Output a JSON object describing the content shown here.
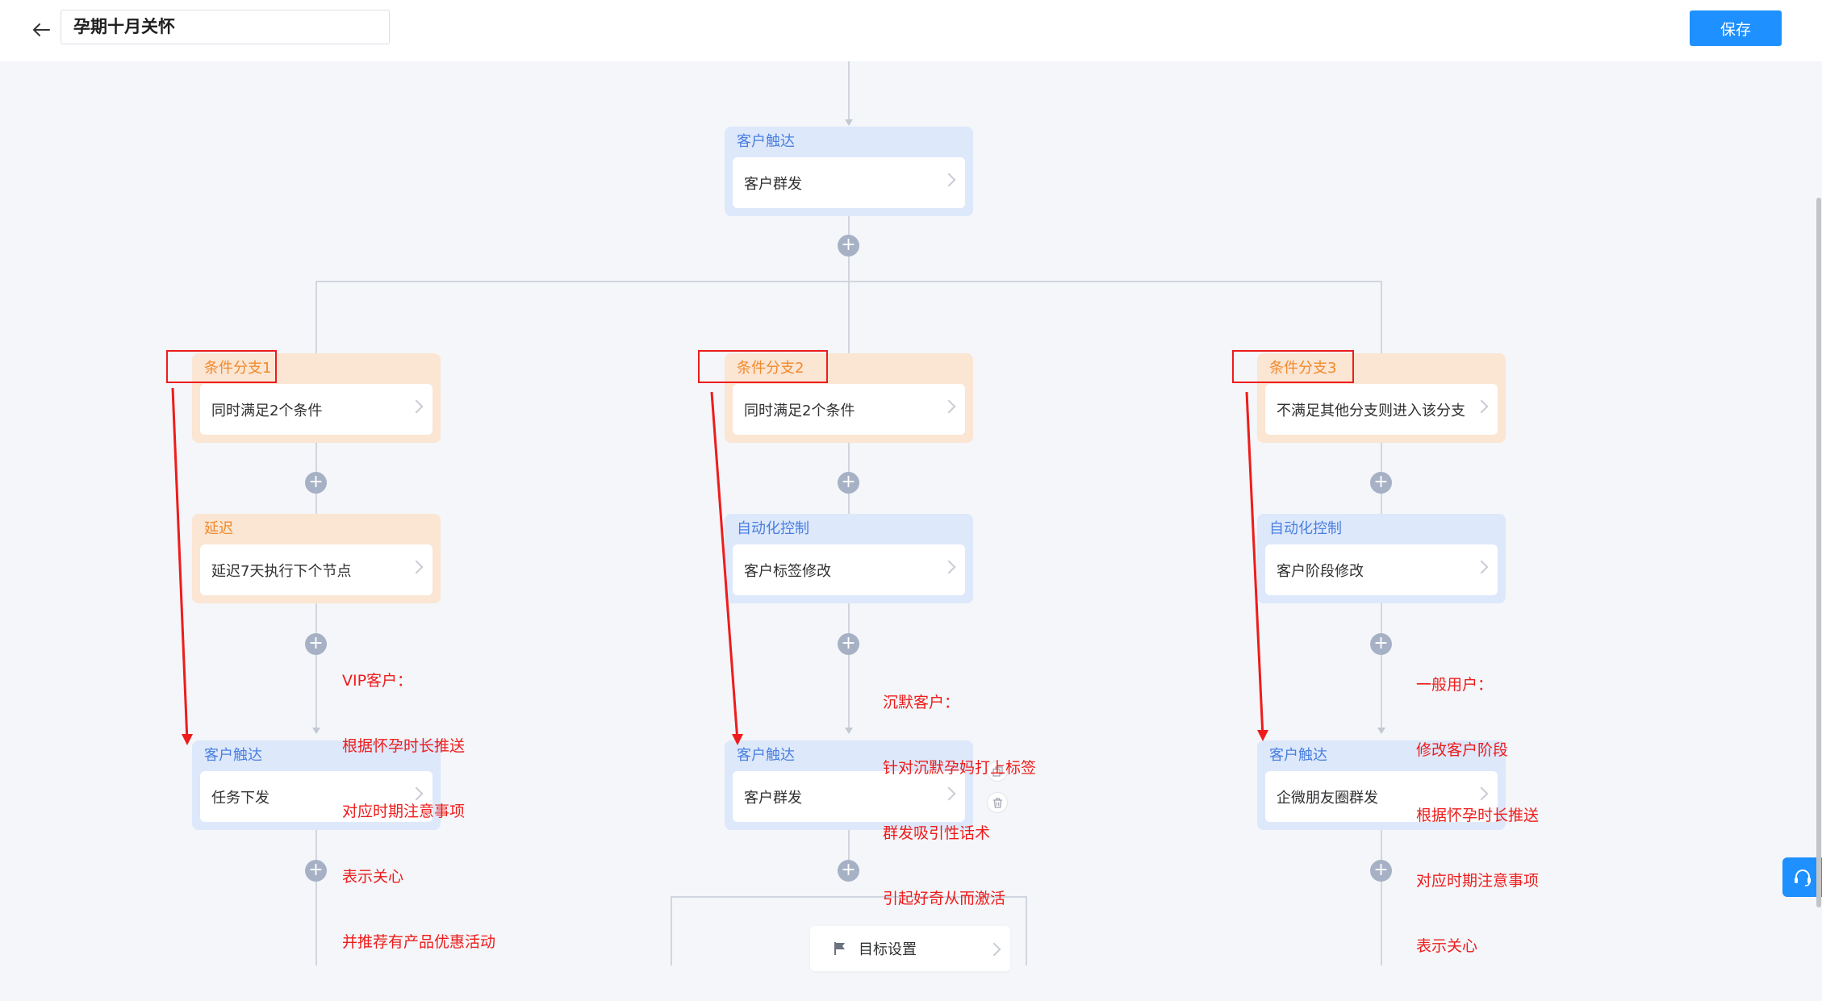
{
  "header": {
    "back_icon": "arrow-left-icon",
    "title": "孕期十月关怀",
    "save_label": "保存"
  },
  "colors": {
    "primary": "#1e90ff",
    "blue_node_bg": "#dde8fb",
    "orange_node_bg": "#fbe5d3",
    "annotation_red": "#ee1c1c"
  },
  "flow": {
    "top_node": {
      "type": "客户触达",
      "action": "客户群发"
    },
    "branches": [
      {
        "condition": {
          "type": "条件分支1",
          "action": "同时满足2个条件"
        },
        "step2": {
          "type": "延迟",
          "action": "延迟7天执行下个节点"
        },
        "step3": {
          "type": "客户触达",
          "action": "任务下发"
        },
        "annotation": [
          "VIP客户：",
          "根据怀孕时长推送",
          "对应时期注意事项",
          "表示关心",
          "并推荐有产品优惠活动"
        ]
      },
      {
        "condition": {
          "type": "条件分支2",
          "action": "同时满足2个条件"
        },
        "step2": {
          "type": "自动化控制",
          "action": "客户标签修改"
        },
        "step3": {
          "type": "客户触达",
          "action": "客户群发"
        },
        "annotation": [
          "沉默客户：",
          "针对沉默孕妈打上标签",
          "群发吸引性话术",
          "引起好奇从而激活"
        ]
      },
      {
        "condition": {
          "type": "条件分支3",
          "action": "不满足其他分支则进入该分支"
        },
        "step2": {
          "type": "自动化控制",
          "action": "客户阶段修改"
        },
        "step3": {
          "type": "客户触达",
          "action": "企微朋友圈群发"
        },
        "annotation": [
          "一般用户：",
          "修改客户阶段",
          "根据怀孕时长推送",
          "对应时期注意事项",
          "表示关心"
        ]
      }
    ],
    "goal": {
      "icon": "flag-icon",
      "label": "目标设置"
    },
    "node_tools": [
      "copy-icon",
      "trash-icon"
    ],
    "add_symbol": "+"
  },
  "side_button": {
    "icon": "headset-icon"
  }
}
